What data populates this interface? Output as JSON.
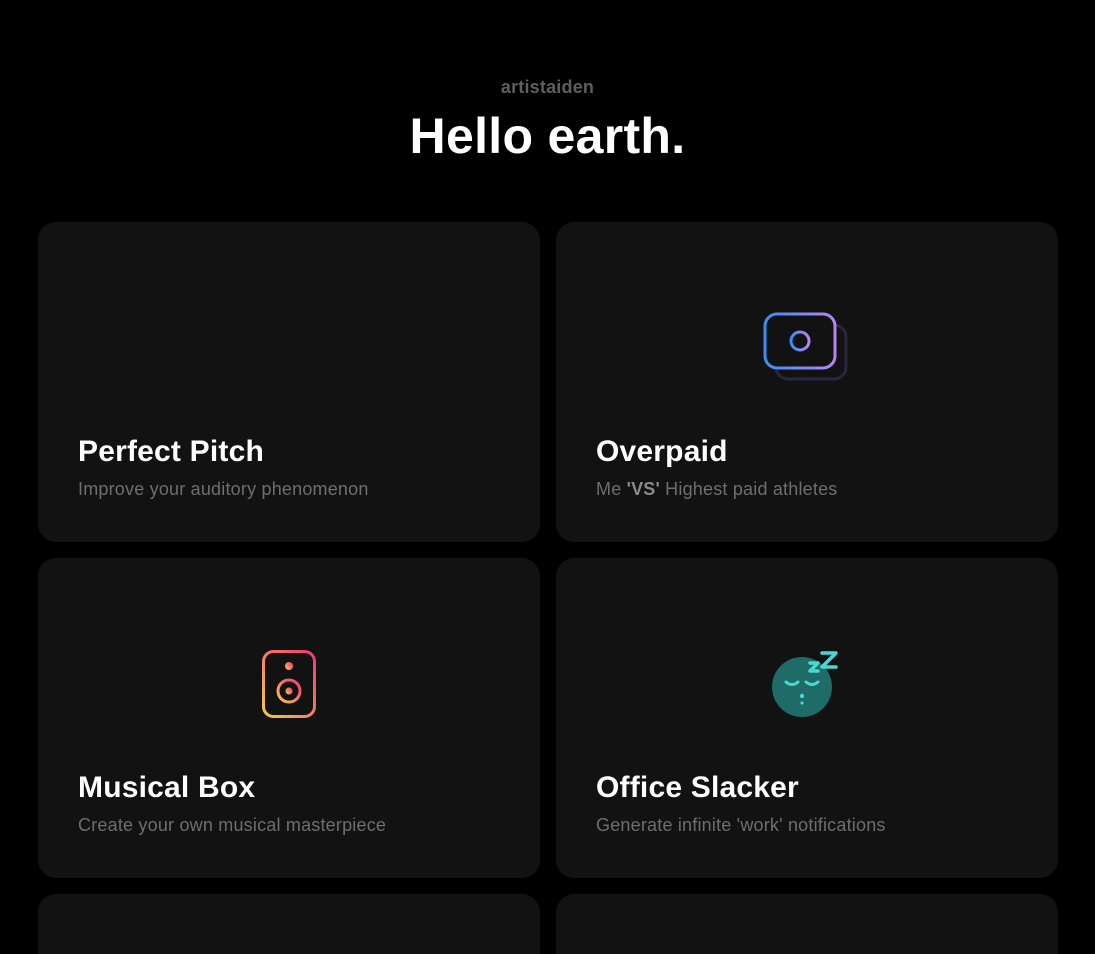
{
  "header": {
    "username": "artistaiden",
    "headline": "Hello earth."
  },
  "apps": [
    {
      "title": "Perfect Pitch",
      "description": "Improve your auditory phenomenon",
      "icon": "sound-wave-icon",
      "accent": [
        "#3ecf8e",
        "#2aa7d9"
      ]
    },
    {
      "title": "Overpaid",
      "description_prefix": "Me ",
      "description_bold": "'VS'",
      "description_suffix": " Highest paid athletes",
      "icon": "money-bill-icon",
      "accent": [
        "#3b8df5",
        "#b07cf0"
      ]
    },
    {
      "title": "Musical Box",
      "description": "Create your own musical masterpiece",
      "icon": "speaker-icon",
      "accent": [
        "#f7c948",
        "#f0357a"
      ]
    },
    {
      "title": "Office Slacker",
      "description": "Generate infinite 'work' notifications",
      "icon": "sleeping-face-icon",
      "accent": [
        "#1e6b68",
        "#3fd1d1"
      ]
    }
  ]
}
